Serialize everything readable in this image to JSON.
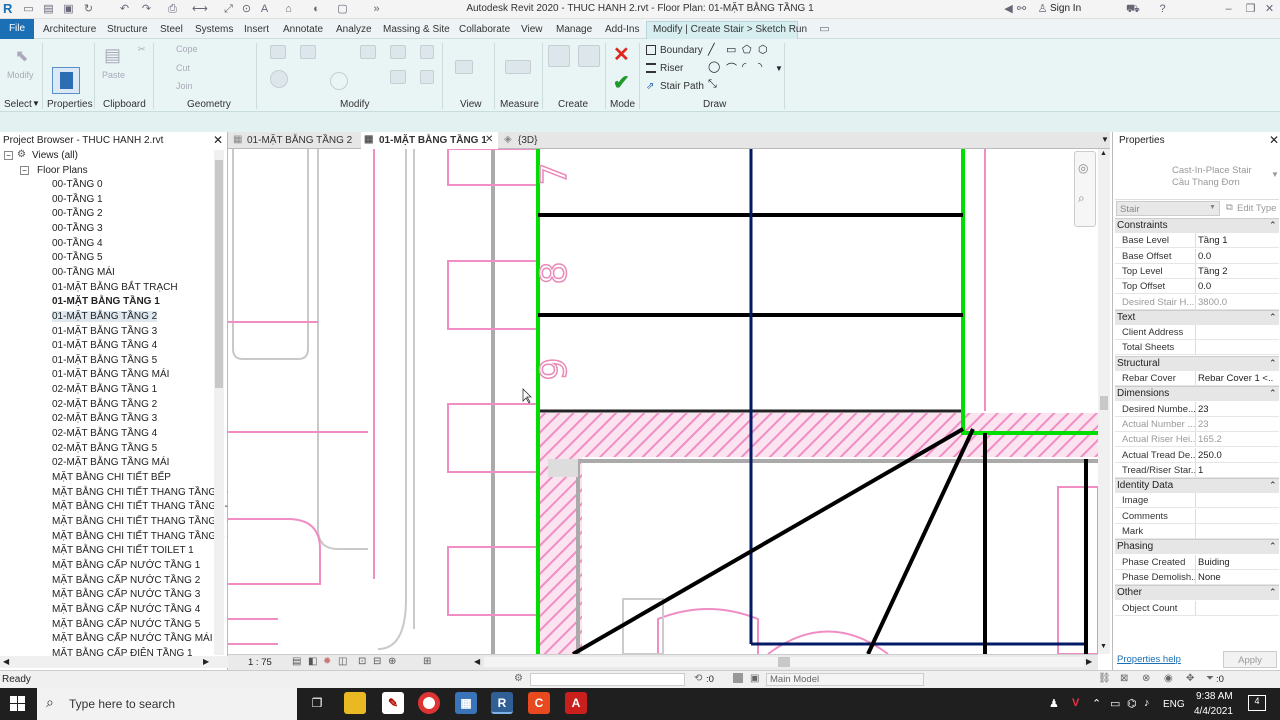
{
  "app": {
    "title": "Autodesk Revit 2020 - THUC HANH 2.rvt - Floor Plan: 01-MẶT BẰNG TẦNG 1",
    "sign_in": "Sign In"
  },
  "menu": {
    "file": "File",
    "tabs": [
      "Architecture",
      "Structure",
      "Steel",
      "Systems",
      "Insert",
      "Annotate",
      "Analyze",
      "Massing & Site",
      "Collaborate",
      "View",
      "Manage",
      "Add-Ins",
      "Modify | Create Stair > Sketch Run"
    ]
  },
  "ribbon": {
    "groups": [
      "Select",
      "Properties",
      "Clipboard",
      "Geometry",
      "Modify",
      "View",
      "Measure",
      "Create",
      "Mode",
      "Draw"
    ],
    "modify_label": "Modify",
    "paste_label": "Paste",
    "properties_label": "Properties",
    "cope_label": "Cope",
    "cut_label": "Cut",
    "join_label": "Join",
    "boundary_label": "Boundary",
    "riser_label": "Riser",
    "stair_path_label": "Stair Path"
  },
  "project_browser": {
    "title": "Project Browser - THUC HANH 2.rvt",
    "root": "Views (all)",
    "group": "Floor Plans",
    "items": [
      "00-TẦNG 0",
      "00-TẦNG 1",
      "00-TẦNG 2",
      "00-TẦNG 3",
      "00-TẦNG 4",
      "00-TẦNG 5",
      "00-TẦNG MÁI",
      "01-MẶT BẰNG BẮT TRẠCH",
      "01-MẶT BẰNG TẦNG 1",
      "01-MẶT BẰNG TẦNG 2",
      "01-MẶT BẰNG TẦNG 3",
      "01-MẶT BẰNG TẦNG 4",
      "01-MẶT BẰNG TẦNG 5",
      "01-MẶT BẰNG TẦNG MÁI",
      "02-MẶT BẰNG TẦNG 1",
      "02-MẶT BẰNG TẦNG 2",
      "02-MẶT BẰNG TẦNG 3",
      "02-MẶT BẰNG TẦNG 4",
      "02-MẶT BẰNG TẦNG 5",
      "02-MẶT BẰNG TẦNG MÁI",
      "MẶT BẰNG CHI TIẾT BẾP",
      "MẶT BẰNG CHI TIẾT THANG TẦNG 1 -",
      "MẶT BẰNG CHI TIẾT THANG TẦNG 2-",
      "MẶT BẰNG CHI TIẾT THANG TẦNG 3 -",
      "MẶT BẰNG CHI TIẾT THANG TẦNG 4 -",
      "MẶT BẰNG CHI TIẾT TOILET 1",
      "MẶT BẰNG CẤP NƯỚC TẦNG 1",
      "MẶT BẰNG CẤP NƯỚC TẦNG 2",
      "MẶT BẰNG CẤP NƯỚC TẦNG 3",
      "MẶT BẰNG CẤP NƯỚC TẦNG 4",
      "MẶT BẰNG CẤP NƯỚC TẦNG 5",
      "MẶT BẰNG CẤP NƯỚC TẦNG MÁI",
      "MẶT BẰNG CẤP ĐIỆN TẦNG 1"
    ]
  },
  "view_tabs": [
    "01-MẶT BẰNG TẦNG 2",
    "01-MẶT BẰNG TẦNG 1",
    "{3D}"
  ],
  "view_status": {
    "scale": "1 : 75"
  },
  "properties": {
    "title": "Properties",
    "type_name": "Cast-In-Place Stair",
    "type_sub": "Cầu Thang Đơn",
    "selector": "Stair",
    "edit_type": "Edit Type",
    "sections": [
      {
        "name": "Constraints",
        "rows": [
          {
            "k": "Base Level",
            "v": "Tầng 1",
            "dim": false
          },
          {
            "k": "Base Offset",
            "v": "0.0",
            "dim": false
          },
          {
            "k": "Top Level",
            "v": "Tầng 2",
            "dim": false
          },
          {
            "k": "Top Offset",
            "v": "0.0",
            "dim": false
          },
          {
            "k": "Desired Stair H...",
            "v": "3800.0",
            "dim": true
          }
        ]
      },
      {
        "name": "Text",
        "rows": [
          {
            "k": "Client Address",
            "v": "",
            "dim": false
          },
          {
            "k": "Total Sheets",
            "v": "",
            "dim": false
          }
        ]
      },
      {
        "name": "Structural",
        "rows": [
          {
            "k": "Rebar Cover",
            "v": "Rebar Cover 1 <...",
            "dim": false
          }
        ]
      },
      {
        "name": "Dimensions",
        "rows": [
          {
            "k": "Desired Numbe...",
            "v": "23",
            "dim": false
          },
          {
            "k": "Actual Number ...",
            "v": "23",
            "dim": true
          },
          {
            "k": "Actual Riser Hei...",
            "v": "165.2",
            "dim": true
          },
          {
            "k": "Actual Tread De...",
            "v": "250.0",
            "dim": false
          },
          {
            "k": "Tread/Riser Star...",
            "v": "1",
            "dim": false
          }
        ]
      },
      {
        "name": "Identity Data",
        "rows": [
          {
            "k": "Image",
            "v": "",
            "dim": false
          },
          {
            "k": "Comments",
            "v": "",
            "dim": false
          },
          {
            "k": "Mark",
            "v": "",
            "dim": false
          }
        ]
      },
      {
        "name": "Phasing",
        "rows": [
          {
            "k": "Phase Created",
            "v": "Buiding",
            "dim": false
          },
          {
            "k": "Phase Demolish...",
            "v": "None",
            "dim": false
          }
        ]
      },
      {
        "name": "Other",
        "rows": [
          {
            "k": "Object Count",
            "v": "",
            "dim": false
          }
        ]
      }
    ],
    "help": "Properties help",
    "apply": "Apply"
  },
  "canvas": {
    "riser_numbers": [
      "7",
      "8",
      "9"
    ]
  },
  "status": {
    "ready": "Ready",
    "zero": ":0",
    "model": "Main Model",
    "filter": ":0"
  },
  "taskbar": {
    "search_placeholder": "Type here to search",
    "lang": "ENG",
    "time": "9:38 AM",
    "date": "4/4/2021",
    "notif": "4"
  },
  "colors": {
    "boundary": "#00dd00",
    "riser": "#000000",
    "path": "#001a66",
    "pink": "#f08dc4",
    "revit_blue": "#1a6fb5"
  }
}
